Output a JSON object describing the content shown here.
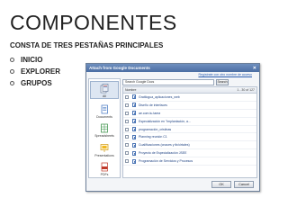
{
  "slide": {
    "title": "COMPONENTES",
    "subtitle": "CONSTA DE TRES PESTAÑAS PRINCIPALES",
    "bullets": [
      "INICIO",
      "EXPLORER",
      "GRUPOS"
    ]
  },
  "dialog": {
    "title": "Attach from Google Documents",
    "close": "✕",
    "hint": "Regístrate con otro nombre de acceso",
    "sidebar": [
      {
        "label": "All",
        "icon": "all-documents-icon",
        "active": true
      },
      {
        "label": "Documents",
        "icon": "document-icon",
        "active": false
      },
      {
        "label": "Spreadsheets",
        "icon": "spreadsheet-icon",
        "active": false
      },
      {
        "label": "Presentations",
        "icon": "presentation-icon",
        "active": false
      },
      {
        "label": "PDFs",
        "icon": "pdf-icon",
        "active": false
      }
    ],
    "search": {
      "value": "Search Google Docs",
      "button": "Search"
    },
    "list": {
      "header_name": "Nombre",
      "pagination": "1 - 30 of 127",
      "items": [
        "Gratilogua_aplicaciones_web",
        "Diseño de interfaces",
        "ae.com.tu.tarea",
        "Especialización en \"Implantación, a...",
        "programación_cristinas",
        "Planning reunión C1",
        "Cualificaciones (cnaces y tb/cirtales)",
        "Proyecto de Especialización JSEE",
        "Programación de Servicios y Procesos"
      ]
    },
    "buttons": {
      "ok": "OK",
      "cancel": "Cancel"
    }
  },
  "colors": {
    "dialog_title_bar": "#5a7db2",
    "link": "#2a5db0",
    "item_text": "#1a3f80"
  }
}
